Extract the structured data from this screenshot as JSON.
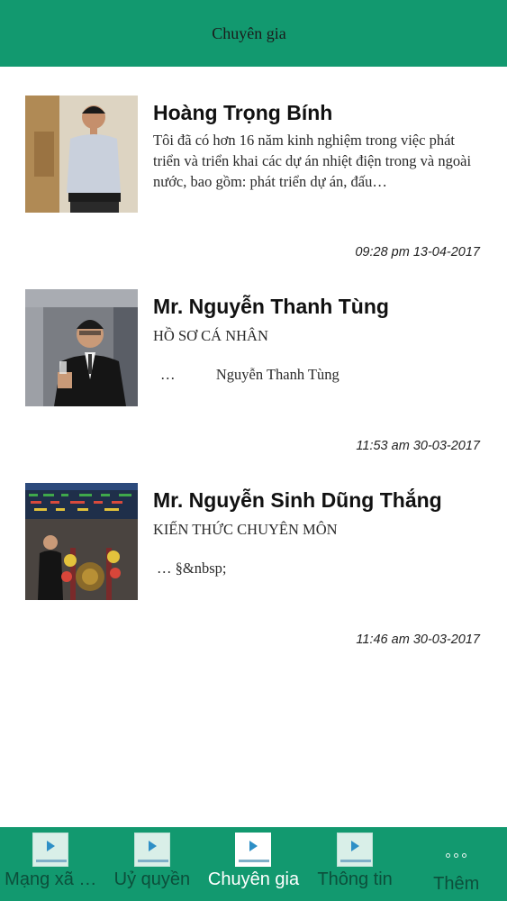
{
  "header": {
    "title": "Chuyên gia"
  },
  "experts": [
    {
      "name": "Hoàng Trọng Bính",
      "description": "Tôi đã có hơn 16 năm kinh nghiệm trong việc phát triển và triển khai các dự án nhiệt điện trong và ngoài nước, bao gồm: phát triển dự án, đấu…",
      "timestamp": "09:28 pm 13-04-2017",
      "avatar_icon": "portrait-photo"
    },
    {
      "name": "Mr. Nguyễn Thanh Tùng",
      "description_line1": "HỒ SƠ CÁ NHÂN",
      "description_line2": "…           Nguyễn Thanh Tùng",
      "timestamp": "11:53 am 30-03-2017",
      "avatar_icon": "portrait-photo"
    },
    {
      "name": "Mr. Nguyễn Sinh Dũng Thắng",
      "description_line1": "KIẾN THỨC CHUYÊN MÔN",
      "description_line2": "… §&nbsp;",
      "timestamp": "11:46 am 30-03-2017",
      "avatar_icon": "portrait-photo"
    }
  ],
  "bottom_nav": {
    "tabs": [
      {
        "label": "Mạng xã …",
        "icon": "app-logo-icon",
        "active": false
      },
      {
        "label": "Uỷ quyền",
        "icon": "app-logo-icon",
        "active": false
      },
      {
        "label": "Chuyên gia",
        "icon": "app-logo-icon",
        "active": true
      },
      {
        "label": "Thông tin",
        "icon": "app-logo-icon",
        "active": false
      },
      {
        "label": "Thêm",
        "icon": "more-dots-icon",
        "active": false
      }
    ]
  },
  "colors": {
    "accent": "#12996f",
    "active_label": "#ffffff",
    "inactive_label": "#0c4f3b"
  }
}
